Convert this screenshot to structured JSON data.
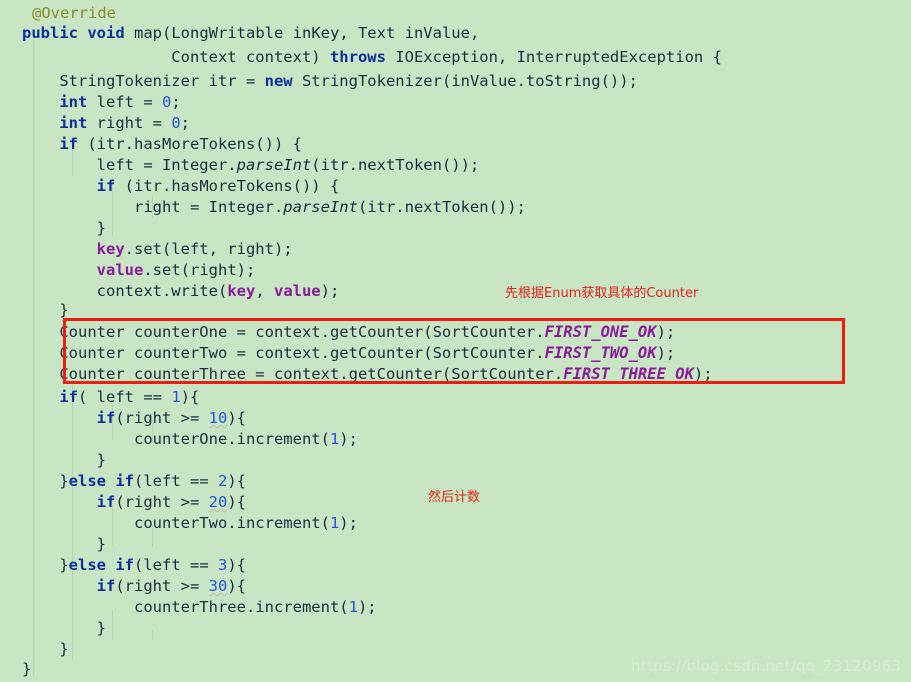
{
  "editor": {
    "background_color": "#c8e6c4",
    "default_text_color": "#1b2b40",
    "keyword_color": "#0d2f9e",
    "number_color": "#2255dd",
    "field_color": "#8c1a9c",
    "annotation_color": "#8b8b2e",
    "guide_line_color": "#b4d6b0",
    "language": "Java"
  },
  "code_lines": [
    {
      "n": 1,
      "indent": 2,
      "text": "@Override"
    },
    {
      "n": 2,
      "indent": 0,
      "text": "public void map(LongWritable inKey, Text inValue,"
    },
    {
      "n": 3,
      "indent": 0,
      "text": "                Context context) throws IOException, InterruptedException {"
    },
    {
      "n": 4,
      "indent": 0,
      "text": "    StringTokenizer itr = new StringTokenizer(inValue.toString());"
    },
    {
      "n": 5,
      "indent": 0,
      "text": "    int left = 0;"
    },
    {
      "n": 6,
      "indent": 0,
      "text": "    int right = 0;"
    },
    {
      "n": 7,
      "indent": 0,
      "text": "    if (itr.hasMoreTokens()) {"
    },
    {
      "n": 8,
      "indent": 0,
      "text": "        left = Integer.parseInt(itr.nextToken());"
    },
    {
      "n": 9,
      "indent": 0,
      "text": "        if (itr.hasMoreTokens()) {"
    },
    {
      "n": 10,
      "indent": 0,
      "text": "            right = Integer.parseInt(itr.nextToken());"
    },
    {
      "n": 11,
      "indent": 0,
      "text": "        }"
    },
    {
      "n": 12,
      "indent": 0,
      "text": "        key.set(left, right);"
    },
    {
      "n": 13,
      "indent": 0,
      "text": "        value.set(right);"
    },
    {
      "n": 14,
      "indent": 0,
      "text": "        context.write(key, value);"
    },
    {
      "n": 15,
      "indent": 0,
      "text": "    }"
    },
    {
      "n": 16,
      "indent": 0,
      "text": "    Counter counterOne = context.getCounter(SortCounter.FIRST_ONE_OK);"
    },
    {
      "n": 17,
      "indent": 0,
      "text": "    Counter counterTwo = context.getCounter(SortCounter.FIRST_TWO_OK);"
    },
    {
      "n": 18,
      "indent": 0,
      "text": "    Counter counterThree = context.getCounter(SortCounter.FIRST_THREE_OK);"
    },
    {
      "n": 19,
      "indent": 0,
      "text": "    if( left == 1){"
    },
    {
      "n": 20,
      "indent": 0,
      "text": "        if(right >= 10){"
    },
    {
      "n": 21,
      "indent": 0,
      "text": "            counterOne.increment(1);"
    },
    {
      "n": 22,
      "indent": 0,
      "text": "        }"
    },
    {
      "n": 23,
      "indent": 0,
      "text": "    }else if(left == 2){"
    },
    {
      "n": 24,
      "indent": 0,
      "text": "        if(right >= 20){"
    },
    {
      "n": 25,
      "indent": 0,
      "text": "            counterTwo.increment(1);"
    },
    {
      "n": 26,
      "indent": 0,
      "text": "        }"
    },
    {
      "n": 27,
      "indent": 0,
      "text": "    }else if(left == 3){"
    },
    {
      "n": 28,
      "indent": 0,
      "text": "        if(right >= 30){"
    },
    {
      "n": 29,
      "indent": 0,
      "text": "            counterThree.increment(1);"
    },
    {
      "n": 30,
      "indent": 0,
      "text": "        }"
    },
    {
      "n": 31,
      "indent": 0,
      "text": "    }"
    },
    {
      "n": 32,
      "indent": 0,
      "text": "}"
    }
  ],
  "highlight_box": {
    "color": "#ee1b11",
    "covers_lines": [
      16,
      17,
      18
    ]
  },
  "annotations": [
    {
      "id": "annotation-enum",
      "text": "先根据Enum获取具体的Counter",
      "color": "#e8201a"
    },
    {
      "id": "annotation-count",
      "text": "然后计数",
      "color": "#e8201a"
    }
  ],
  "watermark": {
    "text": "https://blog.csdn.net/qq_23120963",
    "color": "#d8ebd4"
  }
}
